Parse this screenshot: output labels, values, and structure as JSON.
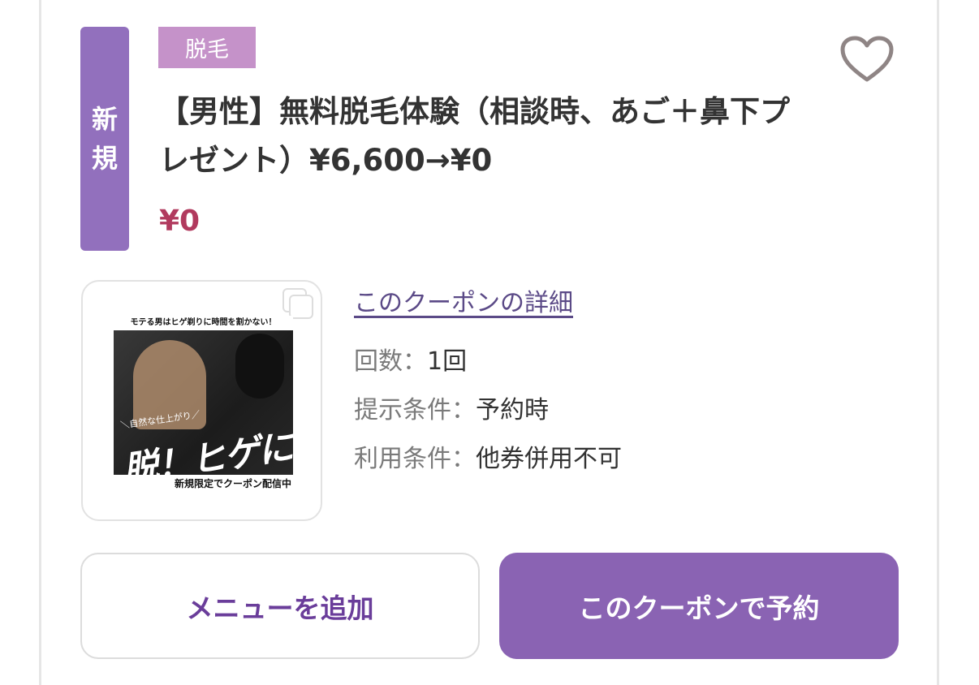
{
  "badge": {
    "line1": "新",
    "line2": "規"
  },
  "category": "脱毛",
  "coupon": {
    "title": "【男性】無料脱毛体験（相談時、あご＋鼻下プレゼント）¥6,600→¥0",
    "price": "¥0"
  },
  "image": {
    "top_text": "モテる男はヒゲ剃りに時間を割かない！",
    "sub_text": "＼自然な仕上がり／",
    "main_text": "脱！ヒゲに",
    "bottom_text": "新規限定でクーポン配信中"
  },
  "details": {
    "link": "このクーポンの詳細",
    "count_label": "回数：",
    "count_value": "1回",
    "present_label": "提示条件：",
    "present_value": "予約時",
    "use_label": "利用条件：",
    "use_value": "他券併用不可"
  },
  "buttons": {
    "add_menu": "メニューを追加",
    "reserve": "このクーポンで予約"
  },
  "icons": {
    "favorite": "heart-icon",
    "copy": "copy-icon"
  },
  "colors": {
    "badge": "#9270bd",
    "category": "#c592c9",
    "price": "#b13a5e",
    "link": "#5b4a87",
    "reserve_button": "#8a63b3",
    "add_button_text": "#6a3d9a"
  }
}
